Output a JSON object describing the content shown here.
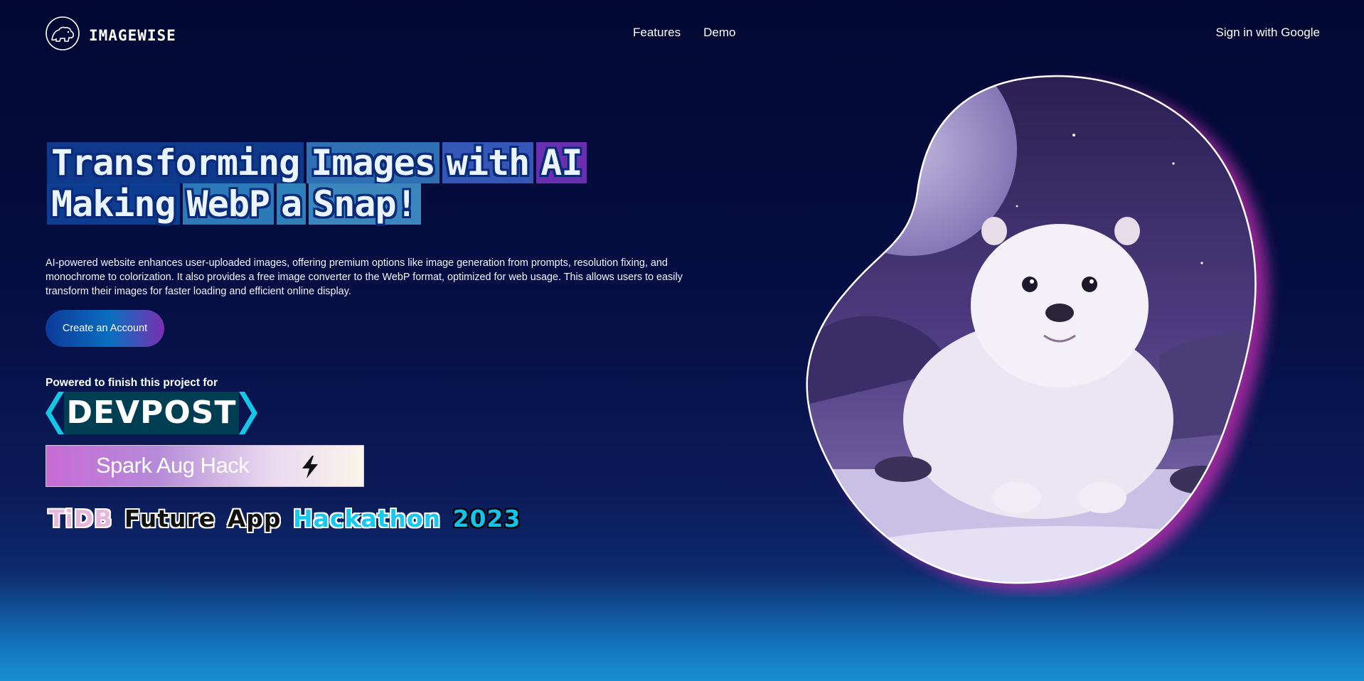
{
  "header": {
    "brand": "IMAGEWISE",
    "nav": [
      "Features",
      "Demo"
    ],
    "signin_label": "Sign in with Google"
  },
  "hero": {
    "headline_line1": [
      "Transforming",
      "Images",
      "with",
      "AI"
    ],
    "headline_line2": [
      "Making",
      "WebP",
      "a",
      "Snap!"
    ],
    "description": "AI-powered website enhances user-uploaded images, offering premium options like image generation from prompts, resolution fixing, and monochrome to colorization. It also provides a free image converter to the WebP format, optimized for web usage. This allows users to easily transform their images for faster loading and efficient online display.",
    "cta_label": "Create an Account",
    "image_icon": "otter-illustration"
  },
  "sponsors": {
    "powered_label": "Powered to finish this project for",
    "devpost": "DEVPOST",
    "spark": "Spark Aug Hack",
    "tidb": [
      "TiDB",
      "Future",
      "App",
      "Hackathon",
      "2023"
    ]
  },
  "colors": {
    "background": "#050f44",
    "accent_blue": "#0a6fc0",
    "accent_purple": "#7a2fb0",
    "glow": "#c42fb0"
  }
}
